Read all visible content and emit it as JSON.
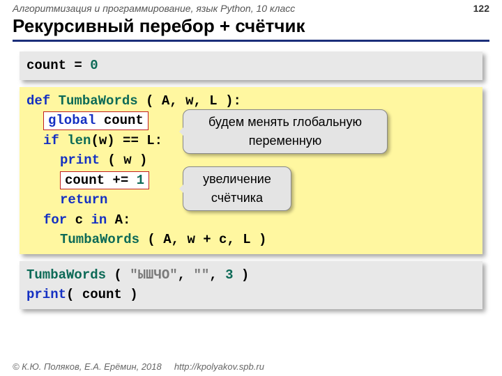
{
  "header": {
    "breadcrumb": "Алгоритмизация и программирование, язык Python, 10 класс",
    "page_number": "122",
    "title": "Рекурсивный перебор + счётчик"
  },
  "code1": {
    "var": "count",
    "eq": " = ",
    "zero": "0"
  },
  "code2": {
    "def": "def",
    "fname": "TumbaWords",
    "sig": " ( A, w, L ):",
    "global_kw": "global",
    "global_var": " count",
    "if_kw": "if",
    "len_fn": "len",
    "if_rest": "(w) == L:",
    "print_kw": "print",
    "print_args": " ( w )",
    "count_inc_a": "count += ",
    "count_inc_b": "1",
    "return_kw": "return",
    "for_kw": "for",
    "for_var": " c ",
    "in_kw": "in",
    "for_rest": " A:",
    "call_fn": "TumbaWords",
    "call_args": " ( A, w + c, L )"
  },
  "callouts": {
    "c1": "будем менять глобальную переменную",
    "c2_a": "увеличение",
    "c2_b": "счётчика"
  },
  "code3": {
    "call_fn": "TumbaWords",
    "call_open": " ( ",
    "str": "\"ЫШЧО\"",
    "call_mid": ", ",
    "str2": "\"\"",
    "call_mid2": ", ",
    "num": "3",
    "call_close": " )",
    "print_kw": "print",
    "print_args": "( count )"
  },
  "footer": {
    "copyright": "© К.Ю. Поляков, Е.А. Ерёмин, 2018",
    "url": "http://kpolyakov.spb.ru"
  }
}
